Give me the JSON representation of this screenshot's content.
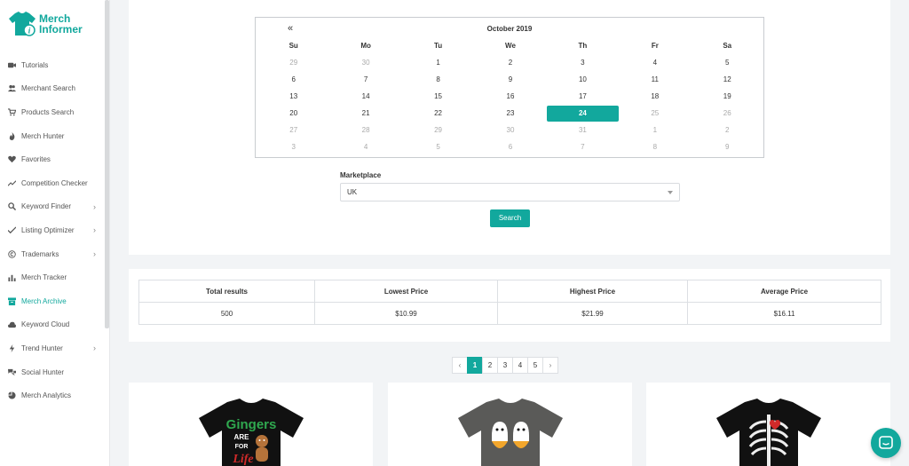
{
  "brand": {
    "line1": "Merch",
    "line2": "Informer",
    "color": "#12a89d"
  },
  "sidebar": {
    "items": [
      {
        "label": "Tutorials",
        "icon": "video-icon",
        "chevron": false,
        "active": false
      },
      {
        "label": "Merchant Search",
        "icon": "users-icon",
        "chevron": false,
        "active": false
      },
      {
        "label": "Products Search",
        "icon": "cart-icon",
        "chevron": false,
        "active": false
      },
      {
        "label": "Merch Hunter",
        "icon": "flame-icon",
        "chevron": false,
        "active": false
      },
      {
        "label": "Favorites",
        "icon": "heart-icon",
        "chevron": false,
        "active": false
      },
      {
        "label": "Competition Checker",
        "icon": "trend-icon",
        "chevron": false,
        "active": false
      },
      {
        "label": "Keyword Finder",
        "icon": "search-icon",
        "chevron": true,
        "active": false
      },
      {
        "label": "Listing Optimizer",
        "icon": "check-icon",
        "chevron": true,
        "active": false
      },
      {
        "label": "Trademarks",
        "icon": "copyright-icon",
        "chevron": true,
        "active": false
      },
      {
        "label": "Merch Tracker",
        "icon": "bar-chart-icon",
        "chevron": false,
        "active": false
      },
      {
        "label": "Merch Archive",
        "icon": "archive-icon",
        "chevron": false,
        "active": true
      },
      {
        "label": "Keyword Cloud",
        "icon": "cloud-icon",
        "chevron": false,
        "active": false
      },
      {
        "label": "Trend Hunter",
        "icon": "bolt-icon",
        "chevron": true,
        "active": false
      },
      {
        "label": "Social Hunter",
        "icon": "chat-bubbles-icon",
        "chevron": false,
        "active": false
      },
      {
        "label": "Merch Analytics",
        "icon": "pie-chart-icon",
        "chevron": false,
        "active": false
      }
    ],
    "chevron_glyph": "›"
  },
  "calendar": {
    "prev": "«",
    "title": "October 2019",
    "weekdays": [
      "Su",
      "Mo",
      "Tu",
      "We",
      "Th",
      "Fr",
      "Sa"
    ],
    "weeks": [
      [
        {
          "d": "29",
          "m": true
        },
        {
          "d": "30",
          "m": true
        },
        {
          "d": "1",
          "m": false
        },
        {
          "d": "2",
          "m": false
        },
        {
          "d": "3",
          "m": false
        },
        {
          "d": "4",
          "m": false
        },
        {
          "d": "5",
          "m": false
        }
      ],
      [
        {
          "d": "6",
          "m": false
        },
        {
          "d": "7",
          "m": false
        },
        {
          "d": "8",
          "m": false
        },
        {
          "d": "9",
          "m": false
        },
        {
          "d": "10",
          "m": false
        },
        {
          "d": "11",
          "m": false
        },
        {
          "d": "12",
          "m": false
        }
      ],
      [
        {
          "d": "13",
          "m": false
        },
        {
          "d": "14",
          "m": false
        },
        {
          "d": "15",
          "m": false
        },
        {
          "d": "16",
          "m": false
        },
        {
          "d": "17",
          "m": false
        },
        {
          "d": "18",
          "m": false
        },
        {
          "d": "19",
          "m": false
        }
      ],
      [
        {
          "d": "20",
          "m": false
        },
        {
          "d": "21",
          "m": false
        },
        {
          "d": "22",
          "m": false
        },
        {
          "d": "23",
          "m": false
        },
        {
          "d": "24",
          "m": false,
          "sel": true
        },
        {
          "d": "25",
          "m": true
        },
        {
          "d": "26",
          "m": true
        }
      ],
      [
        {
          "d": "27",
          "m": true
        },
        {
          "d": "28",
          "m": true
        },
        {
          "d": "29",
          "m": true
        },
        {
          "d": "30",
          "m": true
        },
        {
          "d": "31",
          "m": true
        },
        {
          "d": "1",
          "m": true
        },
        {
          "d": "2",
          "m": true
        }
      ],
      [
        {
          "d": "3",
          "m": true
        },
        {
          "d": "4",
          "m": true
        },
        {
          "d": "5",
          "m": true
        },
        {
          "d": "6",
          "m": true
        },
        {
          "d": "7",
          "m": true
        },
        {
          "d": "8",
          "m": true
        },
        {
          "d": "9",
          "m": true
        }
      ]
    ]
  },
  "marketplace": {
    "label": "Marketplace",
    "value": "UK"
  },
  "search_label": "Search",
  "results": {
    "headers": [
      "Total results",
      "Lowest Price",
      "Highest Price",
      "Average Price"
    ],
    "values": [
      "500",
      "$10.99",
      "$21.99",
      "$16.11"
    ]
  },
  "pagination": {
    "prev": "‹",
    "pages": [
      "1",
      "2",
      "3",
      "4",
      "5"
    ],
    "current": "1",
    "next": "›"
  },
  "products": [
    {
      "shirt_color": "#111111",
      "print_text_1": "Gingers",
      "print_text_2": "ARE",
      "print_text_3": "FOR",
      "print_text_4": "Life"
    },
    {
      "shirt_color": "#5a5a58"
    },
    {
      "shirt_color": "#111111"
    }
  ]
}
